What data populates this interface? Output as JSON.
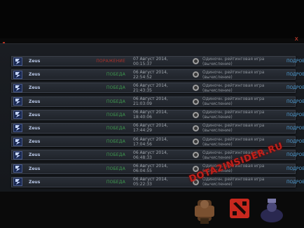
{
  "matches": [
    {
      "hero": "Zeus",
      "result": "ПОРАЖЕНИЕ",
      "result_type": "loss",
      "date": "07 Август 2014, 00:15:37",
      "mode": "Одиночн. рейтинговая игра (вычисление)",
      "details": "ПОДРОБНЕЕ"
    },
    {
      "hero": "Zeus",
      "result": "ПОБЕДА",
      "result_type": "win",
      "date": "06 Август 2014, 22:54:52",
      "mode": "Одиночн. рейтинговая игра (вычисление)",
      "details": "ПОДРОБНЕЕ"
    },
    {
      "hero": "Zeus",
      "result": "ПОБЕДА",
      "result_type": "win",
      "date": "06 Август 2014, 21:43:35",
      "mode": "Одиночн. рейтинговая игра (вычисление)",
      "details": "ПОДРОБНЕЕ"
    },
    {
      "hero": "Zeus",
      "result": "ПОБЕДА",
      "result_type": "win",
      "date": "06 Август 2014, 21:03:09",
      "mode": "Одиночн. рейтинговая игра (вычисление)",
      "details": "ПОДРОБНЕЕ"
    },
    {
      "hero": "Zeus",
      "result": "ПОБЕДА",
      "result_type": "win",
      "date": "06 Август 2014, 18:40:06",
      "mode": "Одиночн. рейтинговая игра (вычисление)",
      "details": "ПОДРОБНЕЕ"
    },
    {
      "hero": "Zeus",
      "result": "ПОБЕДА",
      "result_type": "win",
      "date": "06 Август 2014, 17:44:29",
      "mode": "Одиночн. рейтинговая игра (вычисление)",
      "details": "ПОДРОБНЕЕ"
    },
    {
      "hero": "Zeus",
      "result": "ПОБЕДА",
      "result_type": "win",
      "date": "06 Август 2014, 17:04:56",
      "mode": "Одиночн. рейтинговая игра (вычисление)",
      "details": "ПОДРОБНЕЕ"
    },
    {
      "hero": "Zeus",
      "result": "ПОБЕДА",
      "result_type": "win",
      "date": "06 Август 2014, 06:48:33",
      "mode": "Одиночн. рейтинговая игра (вычисление)",
      "details": "ПОДРОБНЕЕ"
    },
    {
      "hero": "Zeus",
      "result": "ПОБЕДА",
      "result_type": "win",
      "date": "06 Август 2014, 06:04:55",
      "mode": "Одиночн. рейтинговая игра (вычисление)",
      "details": "ПОДРОБНЕЕ"
    },
    {
      "hero": "Zeus",
      "result": "ПОБЕДА",
      "result_type": "win",
      "date": "06 Август 2014, 05:22:33",
      "mode": "Одиночн. рейтинговая игра (вычисление)",
      "details": "ПОДРОБНЕЕ"
    }
  ],
  "close_glyph": "x",
  "watermark": "DOTA2INSIDER.RU",
  "colors": {
    "loss": "#a8302a",
    "win": "#3e9a4e",
    "details": "#4fa0d8",
    "hero": "#b8c8e8"
  }
}
